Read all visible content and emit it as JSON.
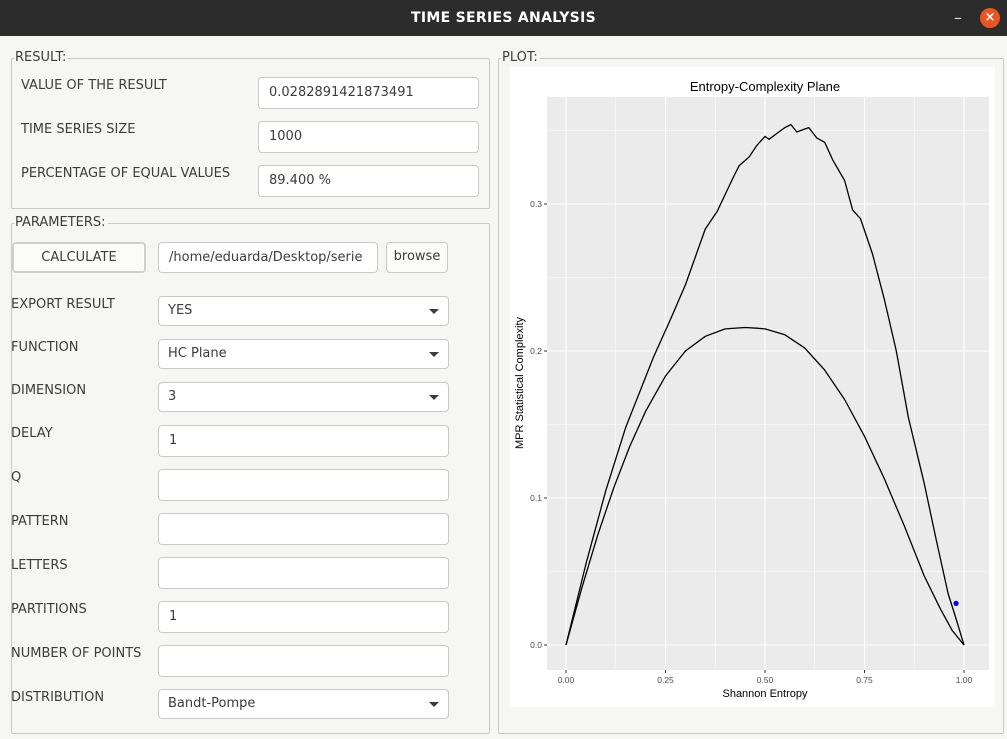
{
  "window": {
    "title": "TIME SERIES ANALYSIS",
    "minimize_glyph": "–",
    "close_glyph": "×"
  },
  "result": {
    "group_title": "RESULT:",
    "value_label": "VALUE OF THE RESULT",
    "value": "0.0282891421873491",
    "size_label": "TIME SERIES SIZE",
    "size": "1000",
    "pct_label": "PERCENTAGE OF EQUAL VALUES",
    "pct": "89.400 %"
  },
  "params": {
    "group_title": "PARAMETERS:",
    "calculate_label": "CALCULATE",
    "path_value": "/home/eduarda/Desktop/serie",
    "browse_label": "browse",
    "export_label": "EXPORT RESULT",
    "export_value": "YES",
    "function_label": "FUNCTION",
    "function_value": "HC Plane",
    "dimension_label": "DIMENSION",
    "dimension_value": "3",
    "delay_label": "DELAY",
    "delay_value": "1",
    "q_label": "Q",
    "q_value": "",
    "pattern_label": "PATTERN",
    "pattern_value": "",
    "letters_label": "LETTERS",
    "letters_value": "",
    "partitions_label": "PARTITIONS",
    "partitions_value": "1",
    "npoints_label": "NUMBER OF POINTS",
    "npoints_value": "",
    "distribution_label": "DISTRIBUTION",
    "distribution_value": "Bandt-Pompe"
  },
  "plot": {
    "group_title": "PLOT:"
  },
  "chart_data": {
    "type": "line",
    "title": "Entropy-Complexity Plane",
    "xlabel": "Shannon Entropy",
    "ylabel": "MPR Statistical Complexity",
    "xlim": [
      0,
      1
    ],
    "ylim": [
      0,
      0.35
    ],
    "x_ticks": [
      "0.00",
      "0.25",
      "0.50",
      "0.75",
      "1.00"
    ],
    "y_ticks": [
      "0.0",
      "0.1",
      "0.2",
      "0.3"
    ],
    "grid": true,
    "colors": {
      "panel": "#ebebeb",
      "grid": "#ffffff",
      "line": "#000000",
      "point": "#0000ff"
    },
    "series": [
      {
        "x": [
          0.0,
          0.05,
          0.1,
          0.15,
          0.22,
          0.26,
          0.3,
          0.35,
          0.38,
          0.42,
          0.435,
          0.46,
          0.48,
          0.5,
          0.51,
          0.53,
          0.55,
          0.565,
          0.58,
          0.6,
          0.61,
          0.63,
          0.65,
          0.67,
          0.7,
          0.72,
          0.74,
          0.77,
          0.8,
          0.83,
          0.86,
          0.9,
          0.93,
          0.96,
          0.98,
          1.0
        ],
        "y": [
          0.0,
          0.055,
          0.105,
          0.148,
          0.196,
          0.22,
          0.245,
          0.283,
          0.295,
          0.318,
          0.326,
          0.332,
          0.34,
          0.346,
          0.344,
          0.348,
          0.352,
          0.354,
          0.349,
          0.351,
          0.352,
          0.345,
          0.342,
          0.33,
          0.316,
          0.296,
          0.29,
          0.266,
          0.235,
          0.2,
          0.155,
          0.11,
          0.072,
          0.035,
          0.018,
          0.0
        ]
      },
      {
        "x": [
          0.0,
          0.04,
          0.08,
          0.12,
          0.16,
          0.2,
          0.25,
          0.3,
          0.35,
          0.4,
          0.45,
          0.48,
          0.5,
          0.55,
          0.6,
          0.65,
          0.7,
          0.75,
          0.8,
          0.85,
          0.9,
          0.94,
          0.97,
          1.0
        ],
        "y": [
          0.0,
          0.039,
          0.075,
          0.107,
          0.135,
          0.159,
          0.183,
          0.2,
          0.21,
          0.215,
          0.216,
          0.2155,
          0.215,
          0.211,
          0.202,
          0.187,
          0.167,
          0.142,
          0.113,
          0.081,
          0.047,
          0.025,
          0.01,
          0.0
        ]
      }
    ],
    "point": {
      "x": 0.98,
      "y": 0.0283
    }
  }
}
